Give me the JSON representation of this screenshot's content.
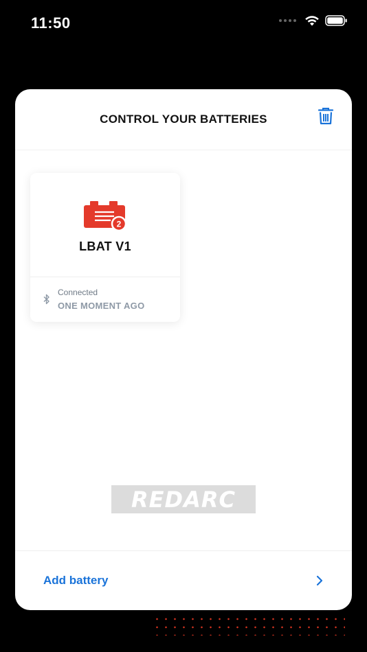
{
  "status_bar": {
    "time": "11:50"
  },
  "modal": {
    "title": "CONTROL YOUR BATTERIES",
    "trash_icon": "trash-icon"
  },
  "batteries": [
    {
      "name": "LBAT V1",
      "badge": "2",
      "connection_status": "Connected",
      "last_seen": "ONE MOMENT AGO",
      "icon": "battery-icon",
      "icon_color": "#e43a2b"
    }
  ],
  "brand": {
    "logo_text": "REDARC"
  },
  "footer": {
    "add_label": "Add battery",
    "chevron": "chevron-right-icon"
  },
  "colors": {
    "accent": "#1a73d9",
    "brand_red": "#d4331f"
  }
}
